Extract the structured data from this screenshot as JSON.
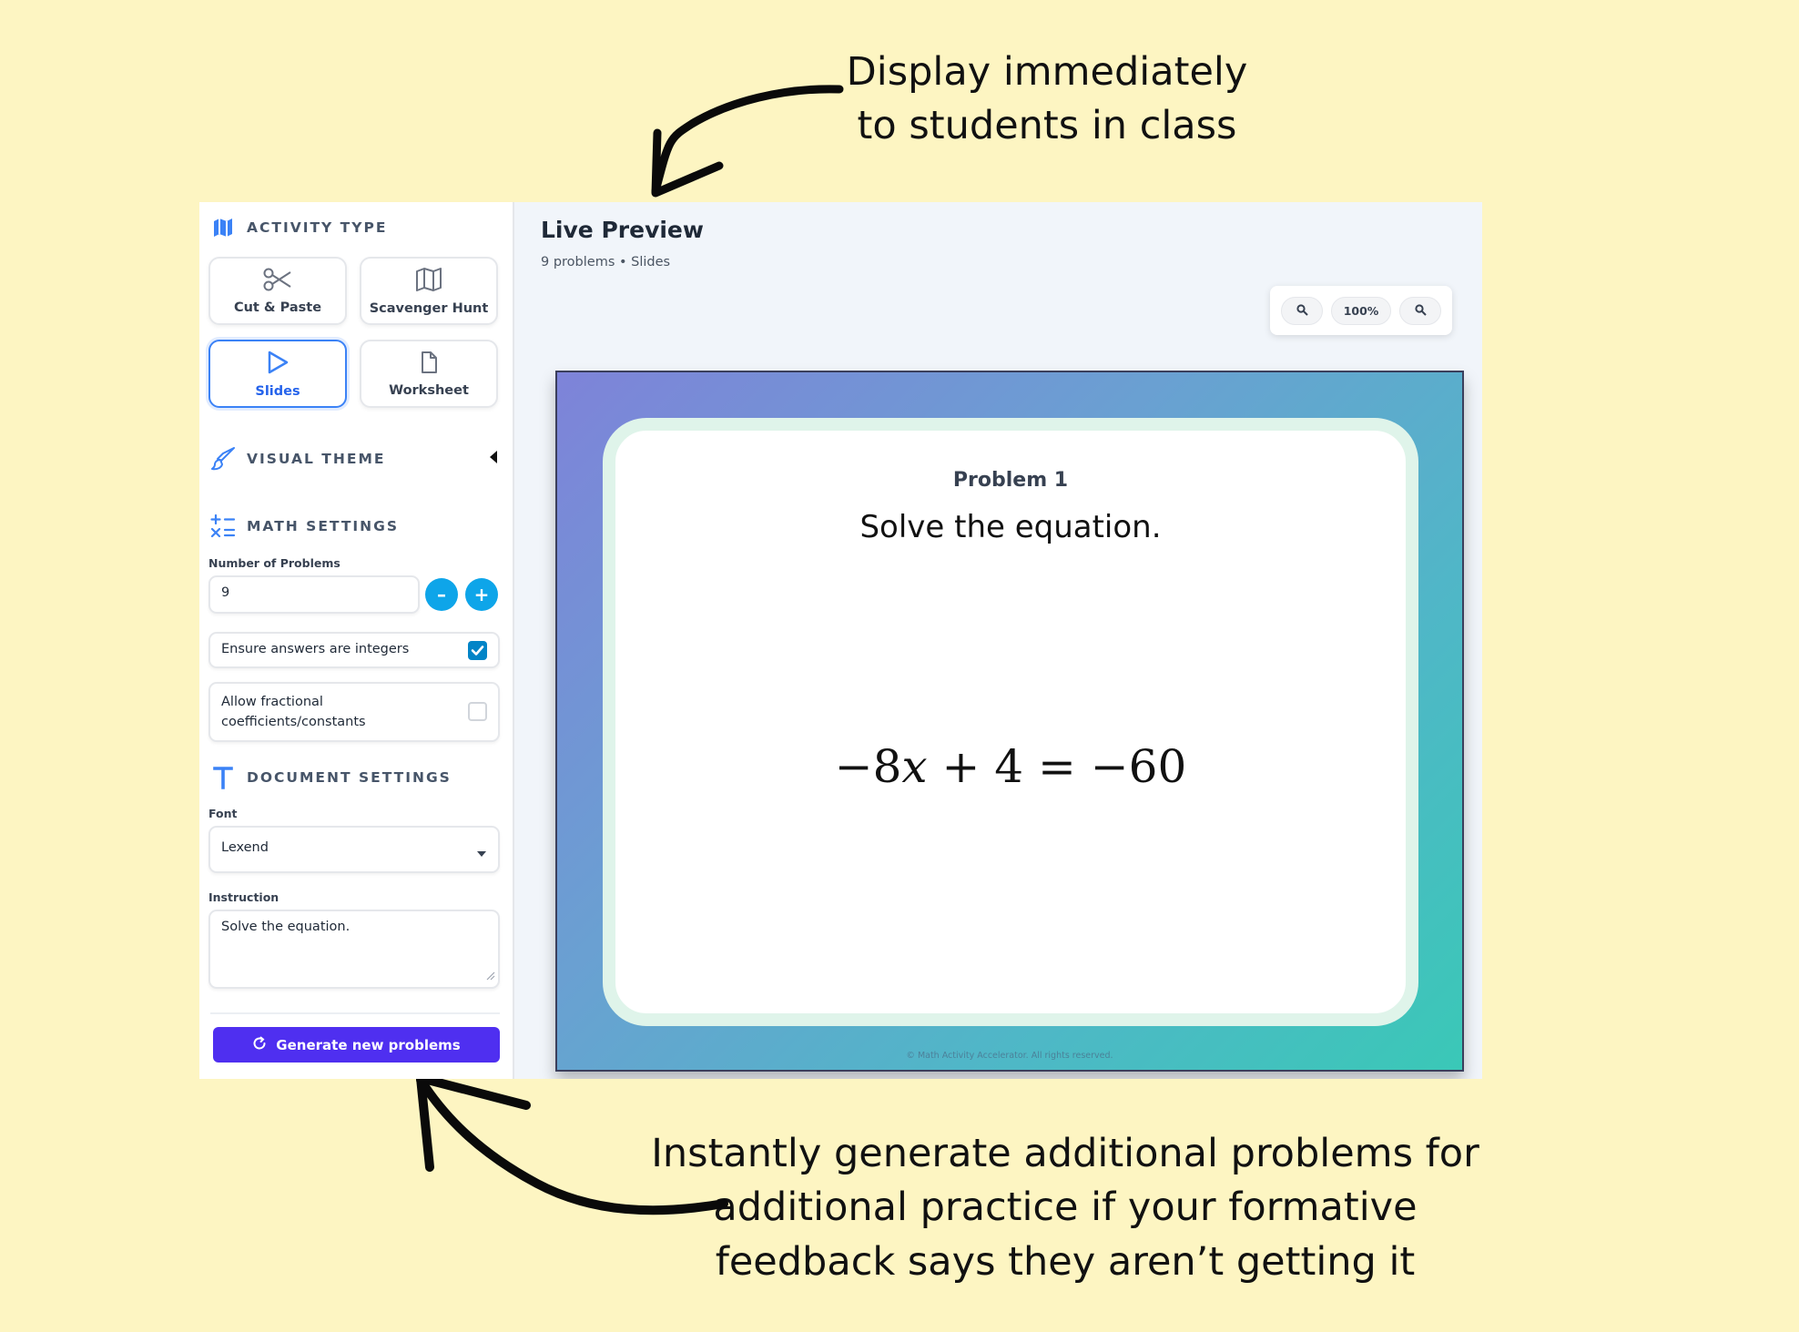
{
  "callouts": {
    "top": [
      "Display immediately",
      "to students in class"
    ],
    "bottom": [
      "Instantly generate additional problems for",
      "additional practice if your formative",
      "feedback says they aren’t getting it"
    ]
  },
  "sidebar": {
    "activity_type": {
      "heading": "ACTIVITY TYPE",
      "options": [
        {
          "label": "Cut & Paste",
          "icon": "scissors-icon",
          "selected": false
        },
        {
          "label": "Scavenger Hunt",
          "icon": "map-icon",
          "selected": false
        },
        {
          "label": "Slides",
          "icon": "play-icon",
          "selected": true
        },
        {
          "label": "Worksheet",
          "icon": "document-icon",
          "selected": false
        }
      ]
    },
    "visual_theme": {
      "heading": "VISUAL THEME"
    },
    "math_settings": {
      "heading": "MATH SETTINGS",
      "num_problems_label": "Number of Problems",
      "num_problems_value": "9",
      "decrement": "–",
      "increment": "+",
      "integer_answers_label": "Ensure answers are integers",
      "integer_answers_checked": true,
      "fractional_label_1": "Allow fractional",
      "fractional_label_2": "coefficients/constants",
      "fractional_checked": false
    },
    "document_settings": {
      "heading": "DOCUMENT SETTINGS",
      "font_label": "Font",
      "font_value": "Lexend",
      "instruction_label": "Instruction",
      "instruction_value": "Solve the equation."
    },
    "generate_button": "Generate new problems"
  },
  "preview": {
    "title": "Live Preview",
    "subtitle": "9 problems • Slides",
    "zoom_level": "100%",
    "slide": {
      "problem_label": "Problem 1",
      "instruction": "Solve the equation.",
      "equation": {
        "minus_a": "−8",
        "variable": "x",
        "rest": " + 4 = −60"
      },
      "footer": "© Math Activity Accelerator. All rights reserved."
    }
  },
  "colors": {
    "background": "#fdf5c2",
    "accent": "#3b82f6",
    "stepper": "#0ea5e9",
    "generate": "#4f2ff0"
  }
}
